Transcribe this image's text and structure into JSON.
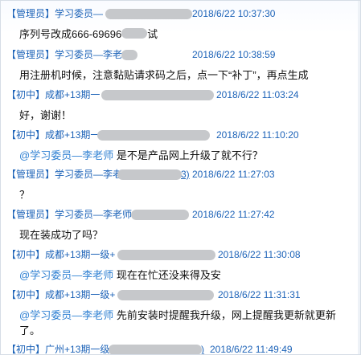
{
  "messages": [
    {
      "role": "【管理员】",
      "name": "学习委员—",
      "time": "2018/6/22 10:37:30",
      "text": "序列号改成666-69696",
      "text_tail": "试"
    },
    {
      "role": "【管理员】",
      "name": "学习委员—李老",
      "handle": "",
      "time": "2018/6/22 10:38:59",
      "text": "用注册机时候，注意黏贴请求码之后，点一下“补丁”，再点生成"
    },
    {
      "role": "【初中】",
      "name": "成都+13期一",
      "time": "2018/6/22 11:03:24",
      "text": "好，谢谢！"
    },
    {
      "role": "【初中】",
      "name": "成都+13期一",
      "time": "2018/6/22 11:10:20",
      "mention": "@学习委员—李老师",
      "text": "是不是产品网上升级了就不行？"
    },
    {
      "role": "【管理员】",
      "name": "学习委员—李老",
      "handle": "3)",
      "time": "2018/6/22 11:27:03",
      "text": "？"
    },
    {
      "role": "【管理员】",
      "name": "学习委员—李老师",
      "time": "2018/6/22 11:27:42",
      "text": "现在装成功了吗？"
    },
    {
      "role": "【初中】",
      "name": "成都+13期一级+",
      "time": "2018/6/22 11:30:08",
      "mention": "@学习委员—李老师",
      "text": "现在在忙还没来得及安"
    },
    {
      "role": "【初中】",
      "name": "成都+13期一级+",
      "time": "2018/6/22 11:31:31",
      "mention": "@学习委员—李老师",
      "text": "先前安装时提醒我升级，网上提醒我更新就更新",
      "text_wrap": "了。"
    },
    {
      "role": "【初中】",
      "name": "广州+13期一级",
      "handle": ")",
      "time": "2018/6/22 11:49:49"
    }
  ]
}
